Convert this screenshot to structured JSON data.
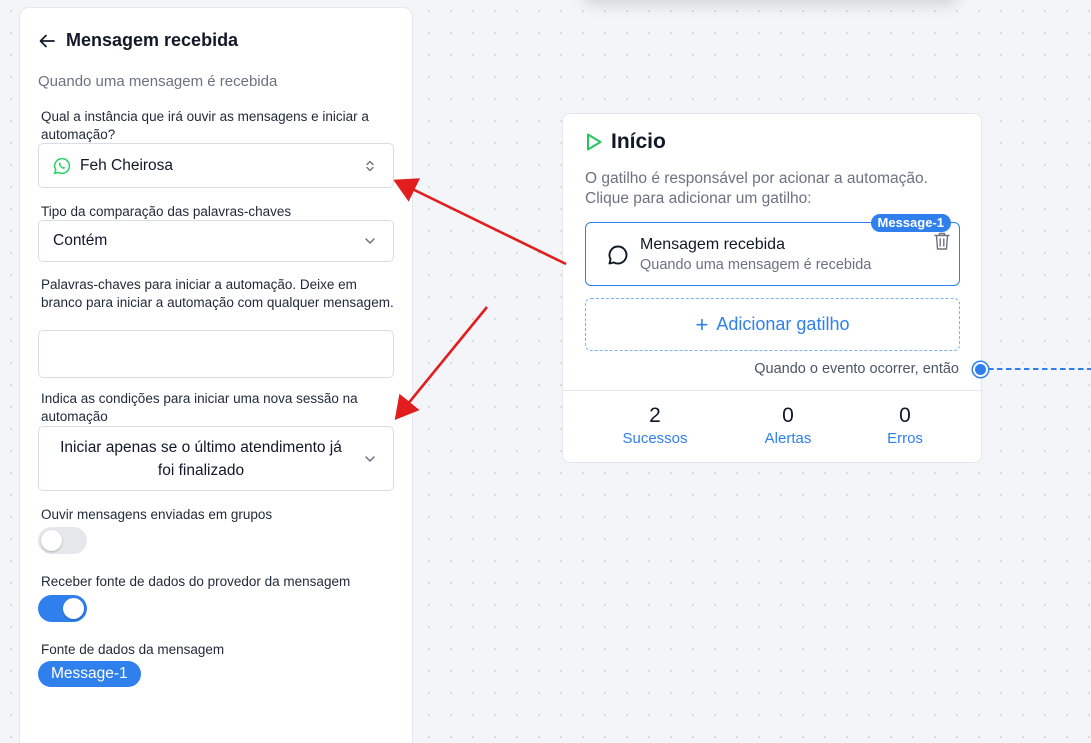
{
  "panel": {
    "title": "Mensagem recebida",
    "subtitle": "Quando uma mensagem é recebida",
    "instance": {
      "label": "Qual a instância que irá ouvir as mensagens e iniciar a automação?",
      "value": "Feh Cheirosa",
      "icon": "whatsapp-icon"
    },
    "comparison": {
      "label": "Tipo da comparação das palavras-chaves",
      "value": "Contém"
    },
    "keywords": {
      "label": "Palavras-chaves para iniciar a automação. Deixe em branco para iniciar a automação com qualquer mensagem.",
      "value": ""
    },
    "session": {
      "label": "Indica as condições para iniciar uma nova sessão na automação",
      "value": "Iniciar apenas se o último atendimento já foi finalizado"
    },
    "groups_toggle": {
      "label": "Ouvir mensagens enviadas em grupos",
      "on": false
    },
    "provider_toggle": {
      "label": "Receber fonte de dados do provedor da mensagem",
      "on": true
    },
    "data_source": {
      "label": "Fonte de dados da mensagem",
      "value": "Message-1"
    }
  },
  "card": {
    "title": "Início",
    "description": "O gatilho é responsável por acionar a automação. Clique para adicionar um gatilho:",
    "trigger": {
      "badge": "Message-1",
      "title": "Mensagem recebida",
      "subtitle": "Quando uma mensagem é recebida"
    },
    "add_trigger_label": "Adicionar gatilho",
    "event_text": "Quando o evento ocorrer, então",
    "stats": [
      {
        "value": "2",
        "label": "Sucessos"
      },
      {
        "value": "0",
        "label": "Alertas"
      },
      {
        "value": "0",
        "label": "Erros"
      }
    ]
  },
  "colors": {
    "accent": "#2f80ed",
    "whatsapp": "#25d366",
    "play": "#22c55e",
    "arrow": "#e11d1d"
  }
}
